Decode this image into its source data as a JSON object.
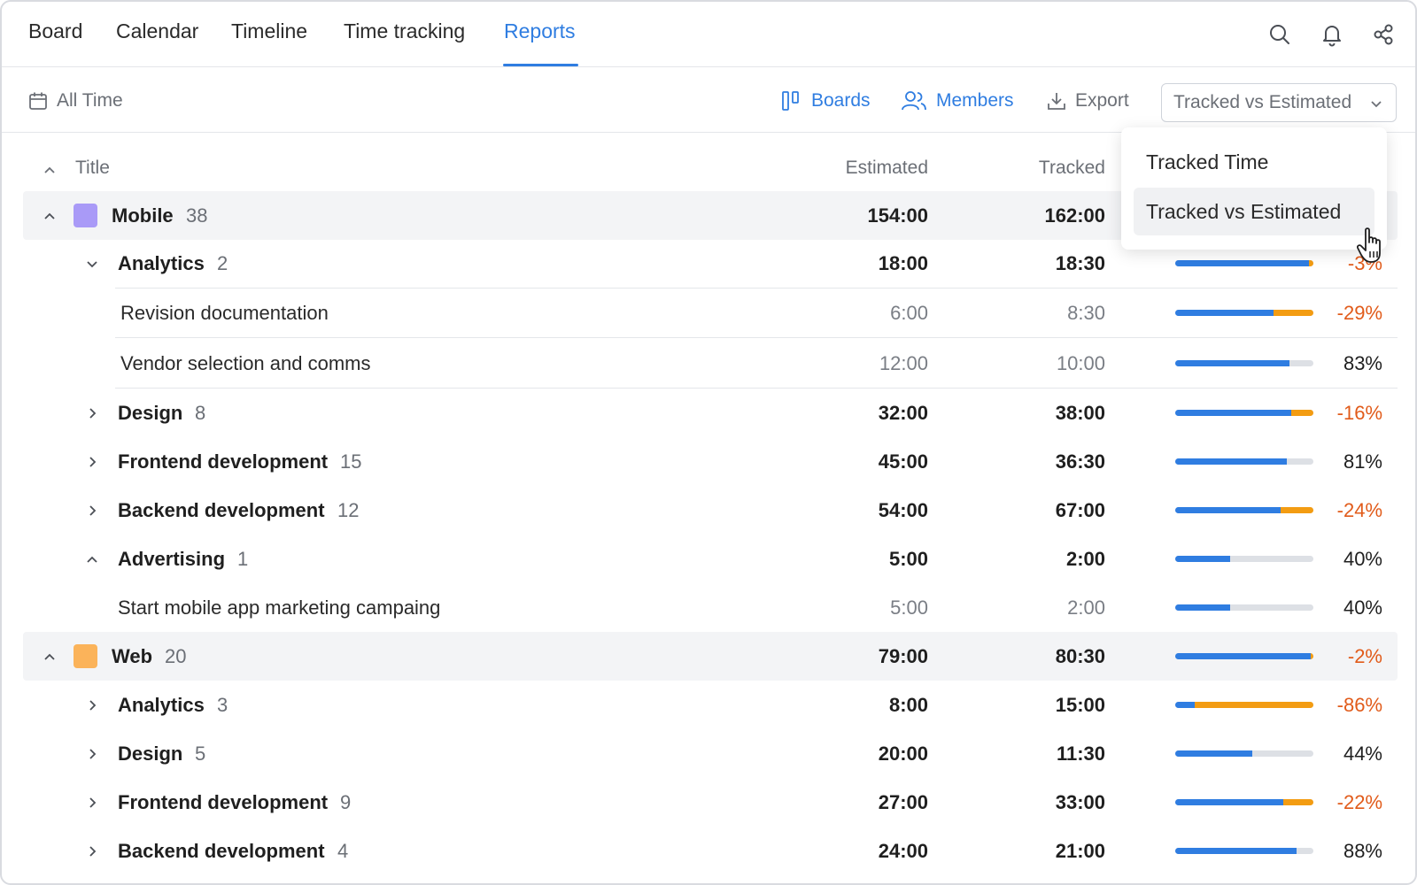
{
  "nav": {
    "tabs": [
      {
        "label": "Board"
      },
      {
        "label": "Calendar"
      },
      {
        "label": "Timeline"
      },
      {
        "label": "Time tracking"
      },
      {
        "label": "Reports"
      }
    ],
    "active_tab": "Reports"
  },
  "toolbar": {
    "date_range": "All Time",
    "boards_label": "Boards",
    "members_label": "Members",
    "export_label": "Export",
    "report_type_selected": "Tracked vs Estimated"
  },
  "report_type_menu": {
    "options": [
      {
        "label": "Tracked Time"
      },
      {
        "label": "Tracked vs Estimated"
      }
    ],
    "highlighted": "Tracked vs Estimated"
  },
  "table": {
    "headers": {
      "title": "Title",
      "estimated": "Estimated",
      "tracked": "Tracked"
    },
    "rows": [
      {
        "kind": "group",
        "title": "Mobile",
        "count": "38",
        "estimated": "154:00",
        "tracked": "162:00",
        "color": "#a99af7",
        "expanded": true
      },
      {
        "kind": "section",
        "title": "Analytics",
        "count": "2",
        "estimated": "18:00",
        "tracked": "18:30",
        "progress": 0.97,
        "over": 0.03,
        "percent": "-3%",
        "negative": true,
        "expanded": true
      },
      {
        "kind": "task",
        "title": "Revision documentation",
        "estimated": "6:00",
        "tracked": "8:30",
        "progress": 0.71,
        "over": 0.29,
        "percent": "-29%",
        "negative": true
      },
      {
        "kind": "task",
        "title": "Vendor selection and comms",
        "estimated": "12:00",
        "tracked": "10:00",
        "progress": 0.83,
        "over": 0,
        "percent": "83%",
        "negative": false
      },
      {
        "kind": "section",
        "title": "Design",
        "count": "8",
        "estimated": "32:00",
        "tracked": "38:00",
        "progress": 0.84,
        "over": 0.16,
        "percent": "-16%",
        "negative": true,
        "expanded": false
      },
      {
        "kind": "section",
        "title": "Frontend development",
        "count": "15",
        "estimated": "45:00",
        "tracked": "36:30",
        "progress": 0.81,
        "over": 0,
        "percent": "81%",
        "negative": false,
        "expanded": false
      },
      {
        "kind": "section",
        "title": "Backend development",
        "count": "12",
        "estimated": "54:00",
        "tracked": "67:00",
        "progress": 0.76,
        "over": 0.24,
        "percent": "-24%",
        "negative": true,
        "expanded": false
      },
      {
        "kind": "section",
        "title": "Advertising",
        "count": "1",
        "estimated": "5:00",
        "tracked": "2:00",
        "progress": 0.4,
        "over": 0,
        "percent": "40%",
        "negative": false,
        "expanded": true
      },
      {
        "kind": "task-noline",
        "title": "Start mobile app marketing campaing",
        "estimated": "5:00",
        "tracked": "2:00",
        "progress": 0.4,
        "over": 0,
        "percent": "40%",
        "negative": false
      },
      {
        "kind": "group",
        "title": "Web",
        "count": "20",
        "estimated": "79:00",
        "tracked": "80:30",
        "color": "#fbb35a",
        "progress": 0.98,
        "over": 0.02,
        "percent": "-2%",
        "negative": true,
        "expanded": true
      },
      {
        "kind": "section",
        "title": "Analytics",
        "count": "3",
        "estimated": "8:00",
        "tracked": "15:00",
        "progress": 0.14,
        "over": 0.86,
        "percent": "-86%",
        "negative": true,
        "expanded": false
      },
      {
        "kind": "section",
        "title": "Design",
        "count": "5",
        "estimated": "20:00",
        "tracked": "11:30",
        "progress": 0.56,
        "over": 0,
        "percent": "44%",
        "negative": false,
        "expanded": false
      },
      {
        "kind": "section",
        "title": "Frontend development",
        "count": "9",
        "estimated": "27:00",
        "tracked": "33:00",
        "progress": 0.78,
        "over": 0.22,
        "percent": "-22%",
        "negative": true,
        "expanded": false
      },
      {
        "kind": "section",
        "title": "Backend development",
        "count": "4",
        "estimated": "24:00",
        "tracked": "21:00",
        "progress": 0.88,
        "over": 0,
        "percent": "88%",
        "negative": false,
        "expanded": false
      }
    ]
  },
  "colors": {
    "accent": "#2f7de1",
    "over_budget": "#f39c12",
    "negative_text": "#e15b1a"
  }
}
